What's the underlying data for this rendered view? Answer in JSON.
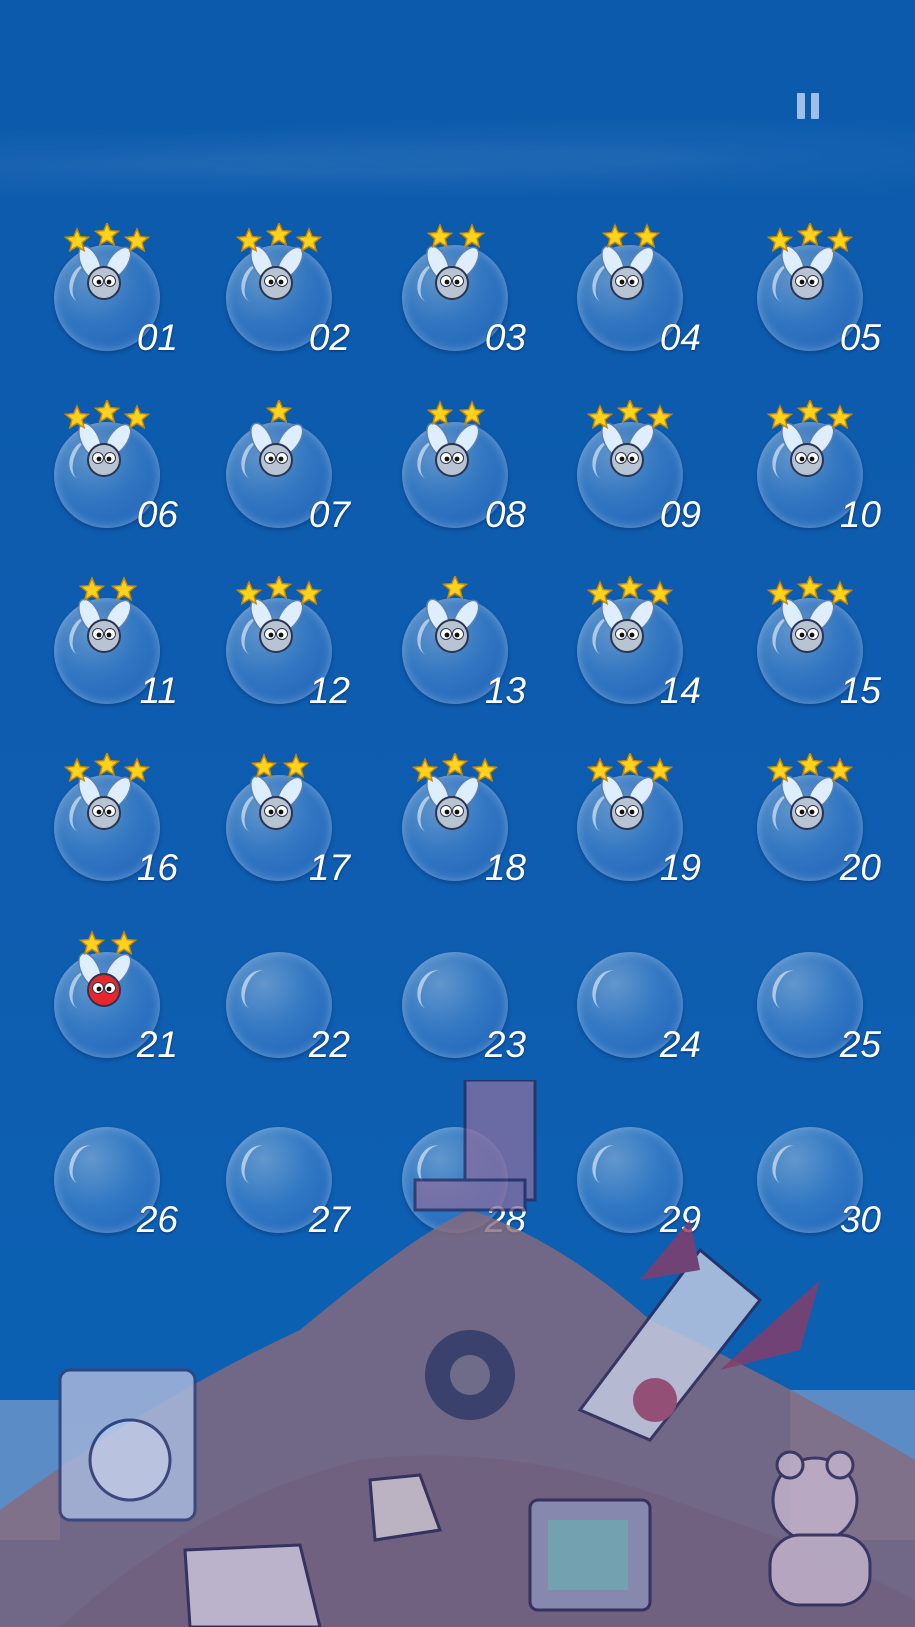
{
  "pause_icon": "pause-icon",
  "levels": [
    {
      "label": "01",
      "stars": 3,
      "state": "done"
    },
    {
      "label": "02",
      "stars": 3,
      "state": "done"
    },
    {
      "label": "03",
      "stars": 2,
      "state": "done"
    },
    {
      "label": "04",
      "stars": 2,
      "state": "done"
    },
    {
      "label": "05",
      "stars": 3,
      "state": "done"
    },
    {
      "label": "06",
      "stars": 3,
      "state": "done"
    },
    {
      "label": "07",
      "stars": 1,
      "state": "done"
    },
    {
      "label": "08",
      "stars": 2,
      "state": "done"
    },
    {
      "label": "09",
      "stars": 3,
      "state": "done"
    },
    {
      "label": "10",
      "stars": 3,
      "state": "done"
    },
    {
      "label": "11",
      "stars": 2,
      "state": "done"
    },
    {
      "label": "12",
      "stars": 3,
      "state": "done"
    },
    {
      "label": "13",
      "stars": 1,
      "state": "done"
    },
    {
      "label": "14",
      "stars": 3,
      "state": "done"
    },
    {
      "label": "15",
      "stars": 3,
      "state": "done"
    },
    {
      "label": "16",
      "stars": 3,
      "state": "done"
    },
    {
      "label": "17",
      "stars": 2,
      "state": "done"
    },
    {
      "label": "18",
      "stars": 3,
      "state": "done"
    },
    {
      "label": "19",
      "stars": 3,
      "state": "done"
    },
    {
      "label": "20",
      "stars": 3,
      "state": "done"
    },
    {
      "label": "21",
      "stars": 2,
      "state": "current"
    },
    {
      "label": "22",
      "stars": 0,
      "state": "locked"
    },
    {
      "label": "23",
      "stars": 0,
      "state": "locked"
    },
    {
      "label": "24",
      "stars": 0,
      "state": "locked"
    },
    {
      "label": "25",
      "stars": 0,
      "state": "locked"
    },
    {
      "label": "26",
      "stars": 0,
      "state": "locked"
    },
    {
      "label": "27",
      "stars": 0,
      "state": "locked"
    },
    {
      "label": "28",
      "stars": 0,
      "state": "locked"
    },
    {
      "label": "29",
      "stars": 0,
      "state": "locked"
    },
    {
      "label": "30",
      "stars": 0,
      "state": "locked"
    }
  ],
  "colors": {
    "star": "#ffd21e",
    "fly_body": "#b8c4d2",
    "current_fly": "#e8262c",
    "wing": "#dfeeff"
  }
}
